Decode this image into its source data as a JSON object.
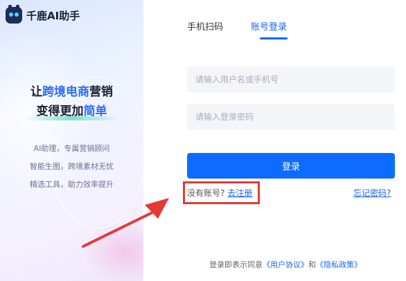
{
  "brand": {
    "name": "千鹿AI助手"
  },
  "promo": {
    "headline1_pre": "让",
    "headline1_hl": "跨境电商",
    "headline1_post": "营销",
    "headline2_pre": "变得更加",
    "headline2_hl": "简单",
    "features": [
      "AI助理，专属营销顾问",
      "智能生图，跨境素材无忧",
      "精选工具，助力效率提升"
    ]
  },
  "tabs": [
    {
      "label": "手机扫码",
      "active": false
    },
    {
      "label": "账号登录",
      "active": true
    }
  ],
  "form": {
    "username_placeholder": "请输入用户名或手机号",
    "password_placeholder": "请输入登录密码",
    "login_label": "登录"
  },
  "links": {
    "no_account": "没有账号?",
    "register": "去注册",
    "forgot": "忘记密码?"
  },
  "agreement": {
    "prefix": "登录即表示同意",
    "user_agreement": "《用户协议》",
    "and": "和",
    "privacy": "《隐私政策》"
  },
  "colors": {
    "accent": "#1463ff",
    "button": "#0e6bff",
    "annotation": "#e53935"
  }
}
